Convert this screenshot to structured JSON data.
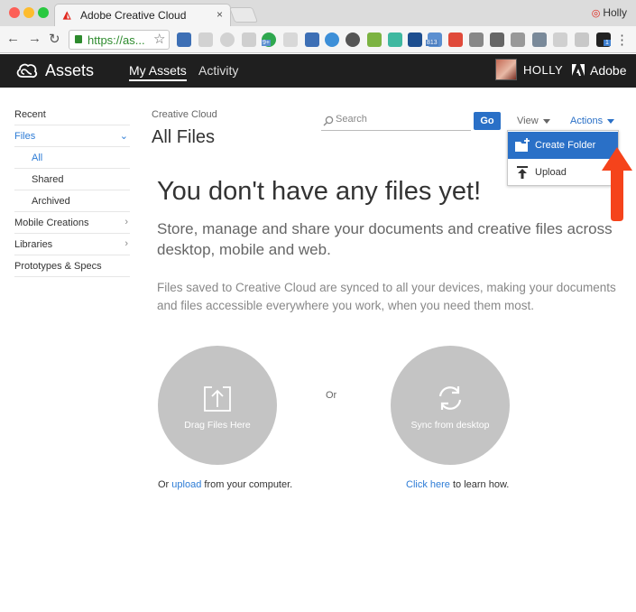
{
  "browser": {
    "tab_title": "Adobe Creative Cloud",
    "tab_close": "×",
    "profile_name": "Holly",
    "url": "https://as...",
    "extension_badges": [
      "9+",
      "813",
      "1"
    ]
  },
  "app": {
    "title": "Assets",
    "nav": [
      "My Assets",
      "Activity"
    ],
    "user": "HOLLY",
    "brand": "Adobe"
  },
  "sidebar": {
    "items": [
      {
        "label": "Recent"
      },
      {
        "label": "Files"
      },
      {
        "label": "All"
      },
      {
        "label": "Shared"
      },
      {
        "label": "Archived"
      },
      {
        "label": "Mobile Creations"
      },
      {
        "label": "Libraries"
      },
      {
        "label": "Prototypes & Specs"
      }
    ]
  },
  "main": {
    "breadcrumb": "Creative Cloud",
    "title": "All Files",
    "search_placeholder": "Search",
    "go_label": "Go",
    "view_label": "View",
    "actions_label": "Actions",
    "actions_menu": [
      "Create Folder",
      "Upload"
    ],
    "empty_title": "You don't have any files yet!",
    "empty_subtitle": "Store, manage and share your documents and creative files across desktop, mobile and web.",
    "empty_description": "Files saved to Creative Cloud are synced to all your devices, making your documents and files accessible everywhere you work, when you need them most.",
    "drag_label": "Drag Files Here",
    "or_label": "Or",
    "sync_label": "Sync from desktop",
    "drag_caption_prefix": "Or",
    "drag_caption_link": "upload",
    "drag_caption_suffix": "from your computer.",
    "sync_caption_link": "Click here",
    "sync_caption_suffix": "to learn how."
  },
  "colors": {
    "accent": "#2a70c7",
    "header_bg": "#1f1f1f",
    "link": "#2d7cd6",
    "annotation_arrow": "#f5431b"
  }
}
